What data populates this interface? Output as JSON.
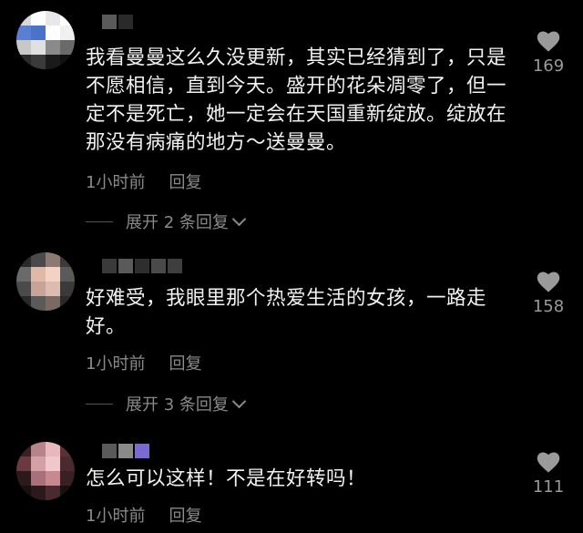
{
  "comments": [
    {
      "text": "我看曼曼这么久没更新，其实已经猜到了，只是不愿相信，直到今天。盛开的花朵凋零了，但一定不是死亡，她一定会在天国重新绽放。绽放在那没有病痛的地方～送曼曼。",
      "time": "1小时前",
      "reply_label": "回复",
      "expand_label": "展开 2 条回复",
      "likes": "169",
      "avatar_colors": [
        "#d9d9d9",
        "#ffffff",
        "#e8e8e8",
        "#ffffff",
        "#5a7fd0",
        "#4a72c9",
        "#ffffff",
        "#f0f0f0",
        "#c8c8c8",
        "#e0e0e0",
        "#8a8a8a",
        "#6a6a6a",
        "#2a2a2a",
        "#3a3a3a",
        "#1a1a1a",
        "#111111"
      ],
      "name_colors": [
        "#5a5a5a",
        "#2a2a2a"
      ]
    },
    {
      "text": "好难受，我眼里那个热爱生活的女孩，一路走好。",
      "time": "1小时前",
      "reply_label": "回复",
      "expand_label": "展开 3 条回复",
      "likes": "158",
      "avatar_colors": [
        "#2a2a2a",
        "#4a4a4a",
        "#8a7a72",
        "#3a3a3a",
        "#6a6a6a",
        "#e0b8a8",
        "#f4d2c2",
        "#5a5a5a",
        "#4a4a4a",
        "#c8a498",
        "#dcbcb0",
        "#3a3a3a",
        "#2a2a2a",
        "#5a5a5a",
        "#7a6a64",
        "#2a2a2a"
      ],
      "name_colors": [
        "#3a3a3a",
        "#5a5a5a",
        "#2e2e2e",
        "#4a4a4a",
        "#3e3e3e"
      ]
    },
    {
      "text": "怎么可以这样！不是在好转吗！",
      "time": "1小时前",
      "reply_label": "回复",
      "likes": "111",
      "avatar_colors": [
        "#3a2026",
        "#b8848c",
        "#e8b8bc",
        "#5a3034",
        "#6a3a40",
        "#d4a0a8",
        "#f0c8cc",
        "#4a2a2e",
        "#2a1a1c",
        "#a8707a",
        "#c88890",
        "#3a2024",
        "#1a1012",
        "#2a1a1c",
        "#4a2a2e",
        "#1a1012"
      ],
      "name_colors": [
        "#5a5a5a",
        "#8a8a8a",
        "#7a6ad0"
      ]
    }
  ]
}
